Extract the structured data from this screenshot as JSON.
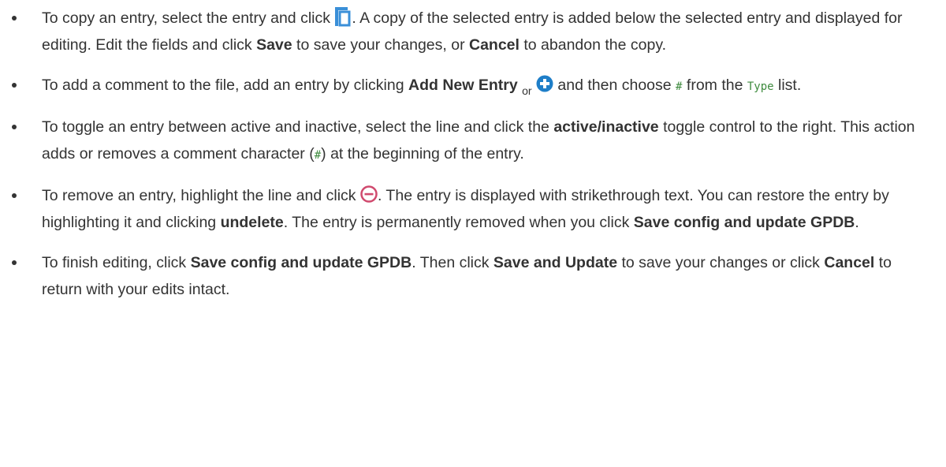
{
  "colors": {
    "text": "#333333",
    "code": "#3f8b3f",
    "copy_icon": "#3a8fd8",
    "add_icon": "#1e7ec8",
    "remove_icon": "#d04a6e"
  },
  "icons": {
    "copy": "copy-icon",
    "add": "add-circle-icon",
    "remove": "remove-circle-icon"
  },
  "items": [
    {
      "t1": "To copy an entry, select the entry and click ",
      "t2": ". A copy of the selected entry is added below the selected entry and displayed for editing. Edit the fields and click ",
      "b1": "Save",
      "t3": " to save your changes, or ",
      "b2": "Cancel",
      "t4": " to abandon the copy."
    },
    {
      "t1": "To add a comment to the file, add an entry by clicking ",
      "b1": "Add New Entry",
      "t2": " ",
      "sub": "or",
      "t3": " ",
      "t4": " and then choose ",
      "c1": "#",
      "t5": " from the ",
      "c2": "Type",
      "t6": " list."
    },
    {
      "t1": "To toggle an entry between active and inactive, select the line and click the ",
      "b1": "active/inactive",
      "t2": " toggle control to the right. This action adds or removes a comment character (",
      "c1": "#",
      "t3": ") at the beginning of the entry."
    },
    {
      "t1": "To remove an entry, highlight the line and click ",
      "t2": ". The entry is displayed with strikethrough text. You can restore the entry by highlighting it and clicking ",
      "b1": "undelete",
      "t3": ". The entry is permanently removed when you click ",
      "b2": "Save config and update GPDB",
      "t4": "."
    },
    {
      "t1": "To finish editing, click ",
      "b1": "Save config and update GPDB",
      "t2": ". Then click ",
      "b2": "Save and Update",
      "t3": " to save your changes or click ",
      "b3": "Cancel",
      "t4": " to return with your edits intact."
    }
  ]
}
